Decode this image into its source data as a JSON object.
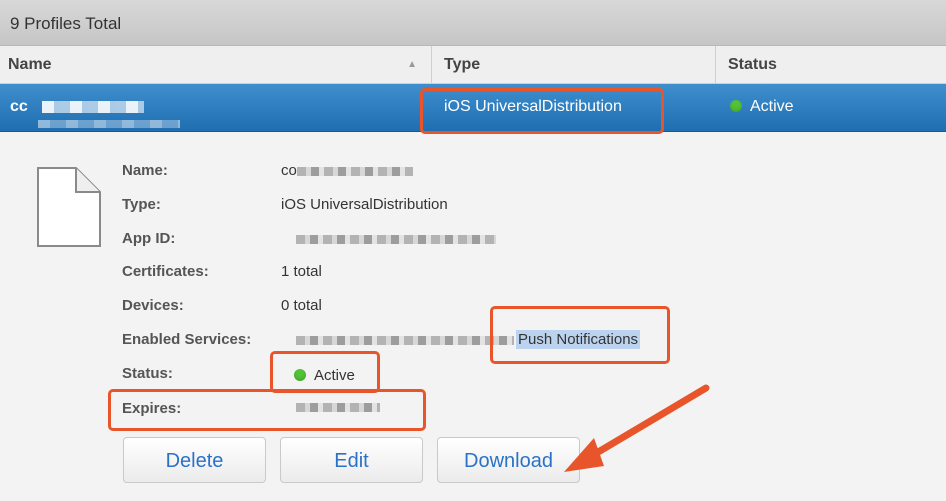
{
  "header": {
    "total_label": "9 Profiles Total"
  },
  "table": {
    "columns": [
      {
        "label": "Name"
      },
      {
        "label": "Type"
      },
      {
        "label": "Status"
      }
    ],
    "selected_row": {
      "name_prefix": "cc",
      "type": "iOS UniversalDistribution",
      "status": "Active"
    }
  },
  "details": {
    "name_label": "Name:",
    "name_prefix": "co",
    "type_label": "Type:",
    "type_value": "iOS UniversalDistribution",
    "app_id_label": "App ID:",
    "certificates_label": "Certificates:",
    "certificates_value": "1 total",
    "devices_label": "Devices:",
    "devices_value": "0 total",
    "services_label": "Enabled Services:",
    "services_value": "Push Notifications",
    "status_label": "Status:",
    "status_value": "Active",
    "expires_label": "Expires:"
  },
  "actions": {
    "delete_label": "Delete",
    "edit_label": "Edit",
    "download_label": "Download"
  },
  "icons": {
    "sort": "sort-ascending-icon",
    "status": "status-dot-icon",
    "file": "file-document-icon"
  },
  "colors": {
    "selection": "#2b7bbf",
    "active_status": "#52c236",
    "annotation": "#e9552b",
    "button_text": "#2a72c8"
  }
}
